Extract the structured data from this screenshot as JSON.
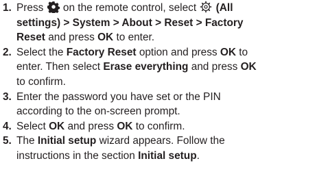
{
  "steps": [
    {
      "number": "1.",
      "line1": {
        "a": "Press",
        "icon": "gear-settings-icon",
        "b": "on the remote control, select",
        "icon2": "settings-dial-icon",
        "c": "(All"
      },
      "line2": "settings) > System > About > Reset > Factory",
      "line3": {
        "a": "Reset",
        "b": "and press",
        "c": "OK",
        "d": "to enter."
      }
    },
    {
      "number": "2.",
      "line1": {
        "a": "Select the",
        "b": "Factory Reset",
        "c": "option and press",
        "d": "OK",
        "e": "to"
      },
      "line2": {
        "a": "enter. Then select",
        "b": "Erase everything",
        "c": "and press",
        "d": "OK"
      },
      "line3": "to confirm."
    },
    {
      "number": "3.",
      "line1": "Enter the password you have set or the PIN",
      "line2": "according to the on-screen prompt."
    },
    {
      "number": "4.",
      "line1": {
        "a": "Select",
        "b": "OK",
        "c": "and press",
        "d": "OK",
        "e": "to confirm."
      }
    },
    {
      "number": "5.",
      "line1": {
        "a": "The",
        "b": "Initial setup",
        "c": "wizard appears. Follow the"
      },
      "line2": {
        "a": "instructions in the section",
        "b": "Initial setup",
        "c": "."
      }
    }
  ]
}
